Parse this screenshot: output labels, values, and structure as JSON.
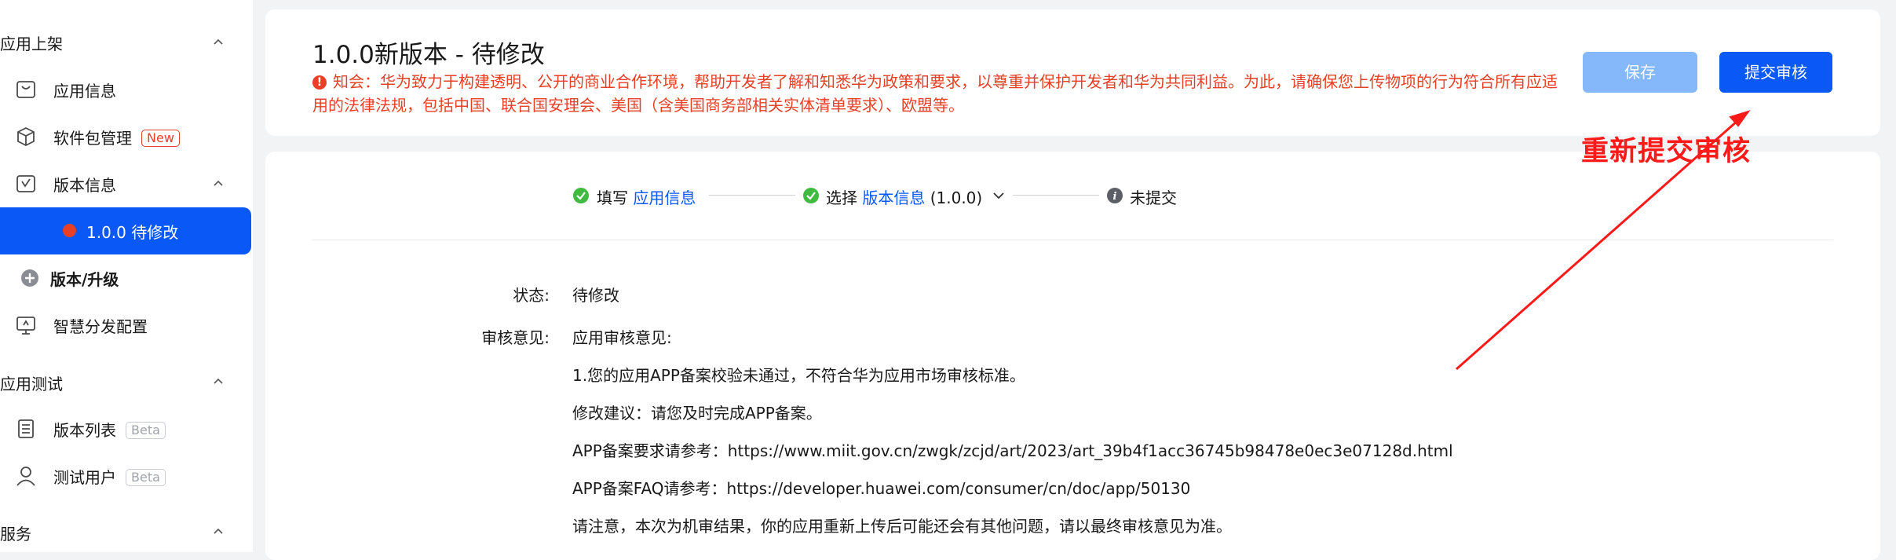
{
  "sidebar": {
    "section_app_listing": "应用上架",
    "items_listing": [
      {
        "label": "应用信息"
      },
      {
        "label": "软件包管理",
        "badge": "New"
      },
      {
        "label": "版本信息"
      }
    ],
    "active_item": "1.0.0 待修改",
    "version_upgrade": "版本/升级",
    "smart_distribution": "智慧分发配置",
    "section_app_test": "应用测试",
    "items_test": [
      {
        "label": "版本列表",
        "badge": "Beta"
      },
      {
        "label": "测试用户",
        "badge": "Beta"
      }
    ],
    "section_service": "服务"
  },
  "header": {
    "title": "1.0.0新版本 - 待修改",
    "notice": "知会：华为致力于构建透明、公开的商业合作环境，帮助开发者了解和知悉华为政策和要求，以尊重并保护开发者和华为共同利益。为此，请确保您上传物项的行为符合所有应适用的法律法规，包括中国、联合国安理会、美国（含美国商务部相关实体清单要求）、欧盟等。",
    "save_label": "保存",
    "submit_label": "提交审核"
  },
  "annotation": {
    "text": "重新提交审核",
    "color": "#ff1a1a"
  },
  "steps": {
    "step1_prefix": "填写",
    "step1_link": "应用信息",
    "step2_prefix": "选择",
    "step2_link": "版本信息",
    "step2_version": "(1.0.0)",
    "step3_label": "未提交"
  },
  "details": {
    "status_label": "状态:",
    "status_value": "待修改",
    "review_label": "审核意见:",
    "review_lines": [
      "应用审核意见:",
      "1.您的应用APP备案校验未通过，不符合华为应用市场审核标准。",
      "修改建议：请您及时完成APP备案。",
      "APP备案要求请参考：https://www.miit.gov.cn/zwgk/zcjd/art/2023/art_39b4f1acc36745b98478e0ec3e07128d.html",
      "APP备案FAQ请参考：https://developer.huawei.com/consumer/cn/doc/app/50130",
      "请注意，本次为机审结果，你的应用重新上传后可能还会有其他问题，请以最终审核意见为准。"
    ]
  },
  "colors": {
    "primary": "#0a59f7",
    "danger": "#e84026",
    "success": "#41ba41",
    "save_disabled": "#84b8fa"
  }
}
